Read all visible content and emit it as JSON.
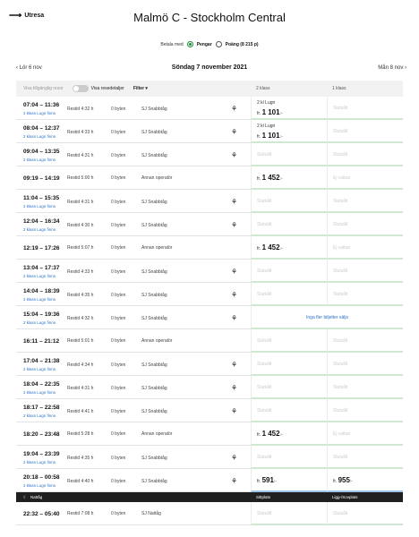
{
  "header": {
    "back_label": "Utresa",
    "back_icon": "arrow-left-icon",
    "title": "Malmö C - Stockholm Central"
  },
  "payment": {
    "label": "Betala med",
    "options": [
      {
        "label": "Pengar",
        "selected": true
      },
      {
        "label": "Poäng (8 215 p)",
        "selected": false
      }
    ]
  },
  "datebar": {
    "prev": "Lör 6 nov",
    "date": "Söndag 7 november 2021",
    "next": "Mån 8 nov"
  },
  "table_header": {
    "hide_unavailable": "Visa tillgänglig resor",
    "details": "Visa resedetaljer",
    "filter": "Filter ▾",
    "class2": "2 klass",
    "class1": "1 klass"
  },
  "trips": [
    {
      "time": "07:04 – 11:36",
      "sub": "2 klass Lugn finns",
      "duration": "Restid 4:32 h",
      "changes": "0 byten",
      "operator": "SJ Snabbtåg",
      "icon": true,
      "c2": {
        "type": "lugn",
        "label": "2 kl Lugn",
        "prefix": "fr.",
        "amount": "1 101",
        "suffix": ":-"
      },
      "c1": {
        "type": "muted",
        "label": "Slutsålt"
      }
    },
    {
      "time": "08:04 – 12:37",
      "sub": "2 klass Lugn finns",
      "duration": "Restid 4:33 h",
      "changes": "0 byten",
      "operator": "SJ Snabbtåg",
      "icon": true,
      "c2": {
        "type": "lugn",
        "label": "2 kl Lugn",
        "prefix": "fr.",
        "amount": "1 101",
        "suffix": ":-"
      },
      "c1": {
        "type": "muted",
        "label": "Slutsålt"
      }
    },
    {
      "time": "09:04 – 13:35",
      "sub": "2 klass Lugn finns",
      "duration": "Restid 4:31 h",
      "changes": "0 byten",
      "operator": "SJ Snabbtåg",
      "icon": true,
      "c2": {
        "type": "muted",
        "label": "Slutsålt"
      },
      "c1": {
        "type": "muted",
        "label": "Slutsålt"
      }
    },
    {
      "time": "09:19 – 14:19",
      "sub": "",
      "duration": "Restid 5:00 h",
      "changes": "0 byten",
      "operator": "Annan operatör",
      "icon": false,
      "c2": {
        "type": "price",
        "prefix": "fr.",
        "amount": "1 452",
        "suffix": ":-"
      },
      "c1": {
        "type": "muted",
        "label": "Ej valbar"
      }
    },
    {
      "time": "11:04 – 15:35",
      "sub": "2 klass Lugn finns",
      "duration": "Restid 4:31 h",
      "changes": "0 byten",
      "operator": "SJ Snabbtåg",
      "icon": true,
      "c2": {
        "type": "muted",
        "label": "Slutsålt"
      },
      "c1": {
        "type": "muted",
        "label": "Slutsålt"
      }
    },
    {
      "time": "12:04 – 16:34",
      "sub": "2 klass Lugn finns",
      "duration": "Restid 4:30 h",
      "changes": "0 byten",
      "operator": "SJ Snabbtåg",
      "icon": true,
      "c2": {
        "type": "muted",
        "label": "Slutsålt"
      },
      "c1": {
        "type": "muted",
        "label": "Slutsålt"
      }
    },
    {
      "time": "12:19 – 17:26",
      "sub": "",
      "duration": "Restid 5:07 h",
      "changes": "0 byten",
      "operator": "Annan operatör",
      "icon": false,
      "c2": {
        "type": "price",
        "prefix": "fr.",
        "amount": "1 452",
        "suffix": ":-"
      },
      "c1": {
        "type": "muted",
        "label": "Ej valbar"
      }
    },
    {
      "time": "13:04 – 17:37",
      "sub": "2 klass Lugn finns",
      "duration": "Restid 4:33 h",
      "changes": "0 byten",
      "operator": "SJ Snabbtåg",
      "icon": true,
      "c2": {
        "type": "muted",
        "label": "Slutsålt"
      },
      "c1": {
        "type": "muted",
        "label": "Slutsålt"
      }
    },
    {
      "time": "14:04 – 18:39",
      "sub": "2 klass Lugn finns",
      "duration": "Restid 4:35 h",
      "changes": "0 byten",
      "operator": "SJ Snabbtåg",
      "icon": true,
      "c2": {
        "type": "muted",
        "label": "Slutsålt"
      },
      "c1": {
        "type": "muted",
        "label": "Slutsålt"
      }
    },
    {
      "time": "15:04 – 19:36",
      "sub": "2 klass Lugn finns",
      "duration": "Restid 4:32 h",
      "changes": "0 byten",
      "operator": "SJ Snabbtåg",
      "icon": true,
      "merged": "Inga fler biljetter säljs"
    },
    {
      "time": "16:11 – 21:12",
      "sub": "",
      "duration": "Restid 5:01 h",
      "changes": "0 byten",
      "operator": "Annan operatör",
      "icon": false,
      "c2": {
        "type": "muted",
        "label": "Slutsålt"
      },
      "c1": {
        "type": "muted",
        "label": "Slutsålt"
      }
    },
    {
      "time": "17:04 – 21:38",
      "sub": "2 klass Lugn finns",
      "duration": "Restid 4:34 h",
      "changes": "0 byten",
      "operator": "SJ Snabbtåg",
      "icon": true,
      "c2": {
        "type": "muted",
        "label": "Slutsålt"
      },
      "c1": {
        "type": "muted",
        "label": "Slutsålt"
      }
    },
    {
      "time": "18:04 – 22:35",
      "sub": "2 klass Lugn finns",
      "duration": "Restid 4:31 h",
      "changes": "0 byten",
      "operator": "SJ Snabbtåg",
      "icon": true,
      "c2": {
        "type": "muted",
        "label": "Slutsålt"
      },
      "c1": {
        "type": "muted",
        "label": "Slutsålt"
      }
    },
    {
      "time": "18:17 – 22:58",
      "sub": "2 klass Lugn finns",
      "duration": "Restid 4:41 h",
      "changes": "0 byten",
      "operator": "SJ Snabbtåg",
      "icon": true,
      "c2": {
        "type": "muted",
        "label": "Slutsålt"
      },
      "c1": {
        "type": "muted",
        "label": "Slutsålt"
      }
    },
    {
      "time": "18:20 – 23:48",
      "sub": "",
      "duration": "Restid 5:28 h",
      "changes": "0 byten",
      "operator": "Annan operatör",
      "icon": false,
      "c2": {
        "type": "price",
        "prefix": "fr.",
        "amount": "1 452",
        "suffix": ":-"
      },
      "c1": {
        "type": "muted",
        "label": "Ej valbar"
      }
    },
    {
      "time": "19:04 – 23:39",
      "sub": "2 klass Lugn finns",
      "duration": "Restid 4:35 h",
      "changes": "0 byten",
      "operator": "SJ Snabbtåg",
      "icon": true,
      "c2": {
        "type": "muted",
        "label": "Slutsålt"
      },
      "c1": {
        "type": "muted",
        "label": "Slutsålt"
      }
    },
    {
      "time": "20:18 – 00:58",
      "sub": "2 klass Lugn finns",
      "duration": "Restid 4:40 h",
      "changes": "0 byten",
      "operator": "SJ Snabbtåg",
      "icon": true,
      "c2": {
        "type": "price",
        "prefix": "fr.",
        "amount": "591",
        "suffix": ":-",
        "blue": true
      },
      "c1": {
        "type": "price",
        "prefix": "fr.",
        "amount": "955",
        "suffix": ":-",
        "blue": true
      }
    }
  ],
  "night": {
    "label": "Nattåg",
    "col1": "Sittplats",
    "col2": "Ligg-/Sovplats"
  },
  "night_trips": [
    {
      "time": "22:32 – 05:40",
      "sub": "",
      "duration": "Restid 7:08 h",
      "changes": "0 byten",
      "operator": "SJ Nattåg",
      "icon": false,
      "c2": {
        "type": "muted",
        "label": "Slutsålt"
      },
      "c1": {
        "type": "muted",
        "label": "Slutsålt"
      }
    }
  ],
  "colors": {
    "accent_green": "#1a8a3a",
    "link_blue": "#2a72c7"
  }
}
